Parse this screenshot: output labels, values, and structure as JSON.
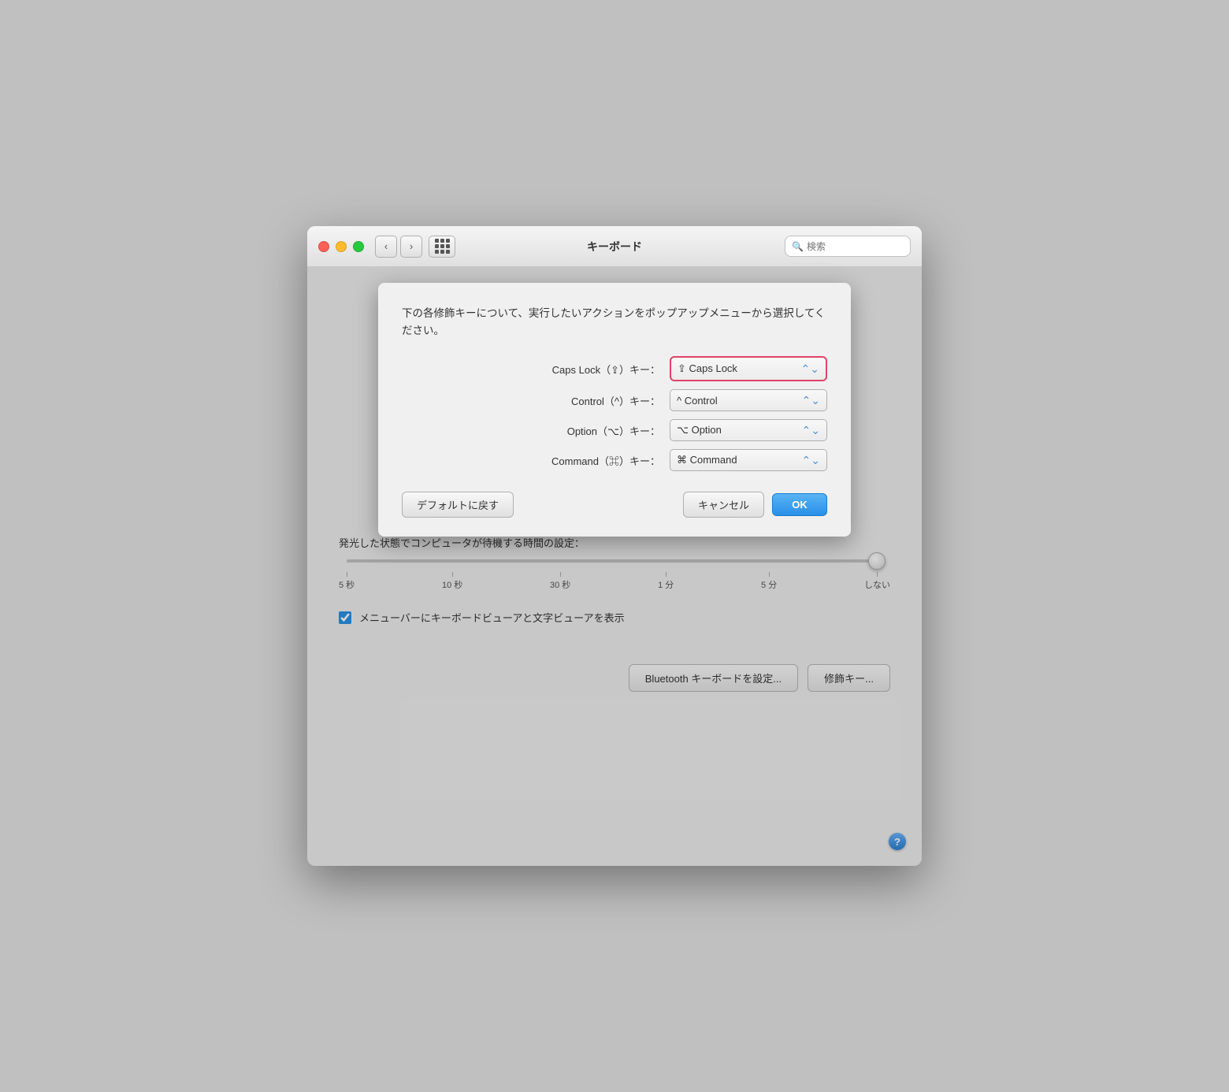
{
  "window": {
    "title": "キーボード"
  },
  "titlebar": {
    "back_label": "‹",
    "forward_label": "›",
    "search_placeholder": "検索"
  },
  "dialog": {
    "description": "下の各修飾キーについて、実行したいアクションをポップアップメニューから選択してください。",
    "rows": [
      {
        "label": "Caps Lock（⇪）キー：",
        "value": "⇪ Caps Lock",
        "highlighted": true
      },
      {
        "label": "Control（^）キー：",
        "value": "^ Control",
        "highlighted": false
      },
      {
        "label": "Option（⌥）キー：",
        "value": "⌥ Option",
        "highlighted": false
      },
      {
        "label": "Command（⌘）キー：",
        "value": "⌘ Command",
        "highlighted": false
      }
    ],
    "reset_button": "デフォルトに戻す",
    "cancel_button": "キャンセル",
    "ok_button": "OK"
  },
  "slider": {
    "label": "発光した状態でコンピュータが待機する時間の設定：",
    "ticks": [
      "5 秒",
      "10 秒",
      "30 秒",
      "1 分",
      "5 分",
      "しない"
    ]
  },
  "checkbox": {
    "checked": true,
    "label": "メニューバーにキーボードビューアと文字ビューアを表示"
  },
  "bottom_buttons": [
    "Bluetooth キーボードを設定...",
    "修飾キー..."
  ],
  "help": {
    "label": "?"
  }
}
